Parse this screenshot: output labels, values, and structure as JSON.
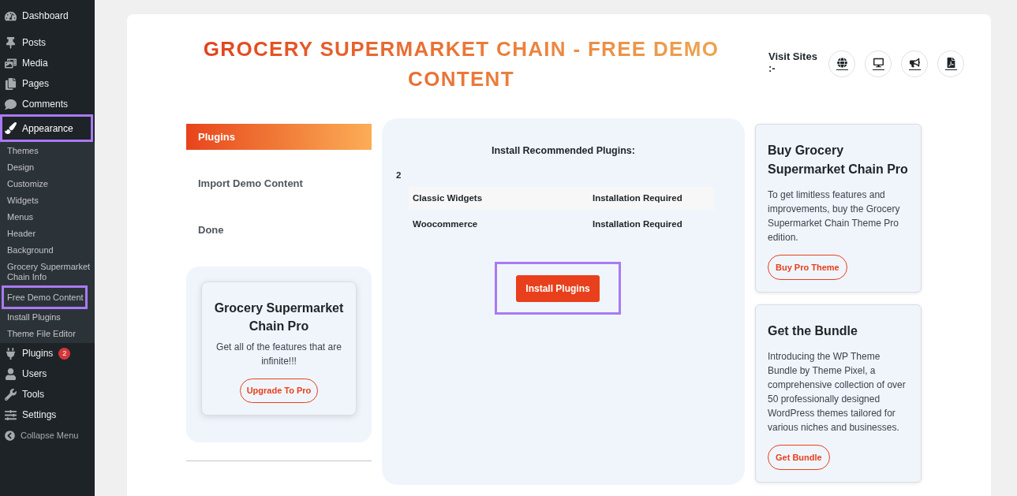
{
  "sidebar": {
    "items": [
      {
        "label": "Dashboard",
        "highlighted": false
      },
      {
        "label": "Posts",
        "highlighted": false
      },
      {
        "label": "Media",
        "highlighted": false
      },
      {
        "label": "Pages",
        "highlighted": false
      },
      {
        "label": "Comments",
        "highlighted": false
      },
      {
        "label": "Appearance",
        "highlighted": true,
        "children": [
          {
            "label": "Themes",
            "highlighted": false
          },
          {
            "label": "Design",
            "highlighted": false
          },
          {
            "label": "Customize",
            "highlighted": false
          },
          {
            "label": "Widgets",
            "highlighted": false
          },
          {
            "label": "Menus",
            "highlighted": false
          },
          {
            "label": "Header",
            "highlighted": false
          },
          {
            "label": "Background",
            "highlighted": false
          },
          {
            "label": "Grocery Supermarket Chain Info",
            "highlighted": false
          },
          {
            "label": "Free Demo Content",
            "highlighted": true
          },
          {
            "label": "Install Plugins",
            "highlighted": false
          },
          {
            "label": "Theme File Editor",
            "highlighted": false
          }
        ]
      },
      {
        "label": "Plugins",
        "highlighted": false,
        "badge": "2"
      },
      {
        "label": "Users",
        "highlighted": false
      },
      {
        "label": "Tools",
        "highlighted": false
      },
      {
        "label": "Settings",
        "highlighted": false
      }
    ],
    "collapse_label": "Collapse Menu"
  },
  "header": {
    "title": "GROCERY SUPERMARKET CHAIN - FREE DEMO CONTENT",
    "visit_sites_label": "Visit Sites :-"
  },
  "steps": [
    {
      "label": "Plugins",
      "selected": true
    },
    {
      "label": "Import Demo Content",
      "selected": false
    },
    {
      "label": "Done",
      "selected": false
    }
  ],
  "pro_box": {
    "title": "Grocery Supermarket Chain Pro",
    "text": "Get all of the features that are infinite!!!",
    "button": "Upgrade To Pro"
  },
  "plugins_panel": {
    "heading": "Install Recommended Plugins:",
    "count": "2",
    "rows": [
      {
        "name": "Classic Widgets",
        "status": "Installation Required"
      },
      {
        "name": "Woocommerce",
        "status": "Installation Required"
      }
    ],
    "button": {
      "label": "Install Plugins",
      "highlighted": true
    }
  },
  "promo_cards": [
    {
      "title": "Buy Grocery Supermarket Chain Pro",
      "text": "To get limitless features and improvements, buy the Grocery Supermarket Chain Theme Pro edition.",
      "button": "Buy Pro Theme"
    },
    {
      "title": "Get the Bundle",
      "text": "Introducing the WP Theme Bundle by Theme Pixel, a comprehensive collection of over 50 professionally designed WordPress themes tailored for various niches and businesses.",
      "button": "Get Bundle"
    }
  ]
}
